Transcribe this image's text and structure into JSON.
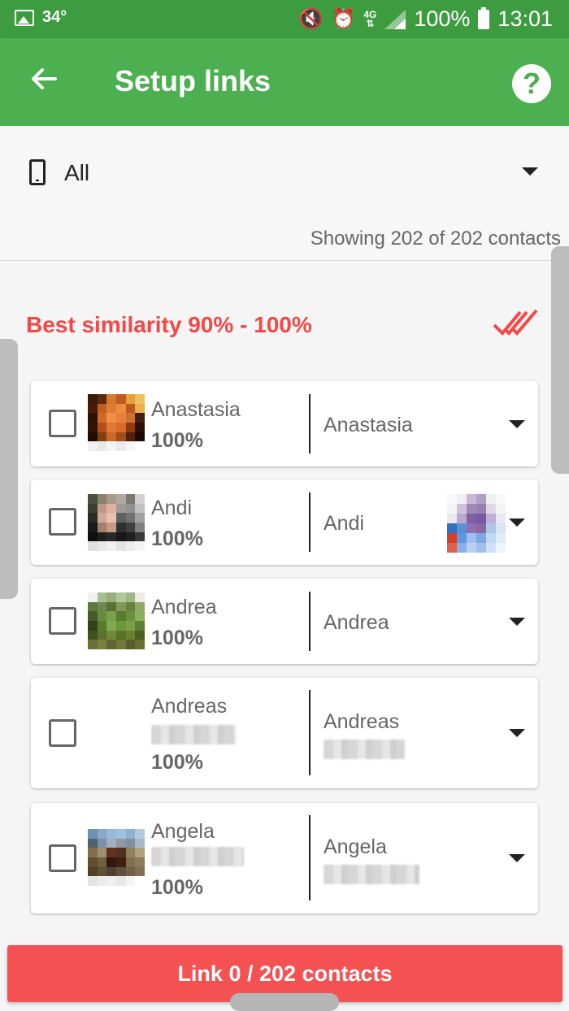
{
  "status_bar": {
    "temperature": "34°",
    "network": "4G",
    "battery": "100%",
    "time": "13:01"
  },
  "app_bar": {
    "title": "Setup links"
  },
  "filter": {
    "value": "All",
    "showing": "Showing 202 of 202 contacts"
  },
  "section": {
    "title": "Best similarity 90% - 100%"
  },
  "contacts": [
    {
      "name": "Anastasia",
      "similarity": "100%",
      "match": "Anastasia"
    },
    {
      "name": "Andi",
      "similarity": "100%",
      "match": "Andi"
    },
    {
      "name": "Andrea",
      "similarity": "100%",
      "match": "Andrea"
    },
    {
      "name": "Andreas",
      "similarity": "100%",
      "match": "Andreas"
    },
    {
      "name": "Angela",
      "similarity": "100%",
      "match": "Angela"
    }
  ],
  "link_button": {
    "label": "Link 0 / 202 contacts"
  },
  "colors": {
    "primary": "#4caf50",
    "primary_dark": "#3e9c40",
    "accent": "#f44848",
    "button": "#f45252"
  }
}
